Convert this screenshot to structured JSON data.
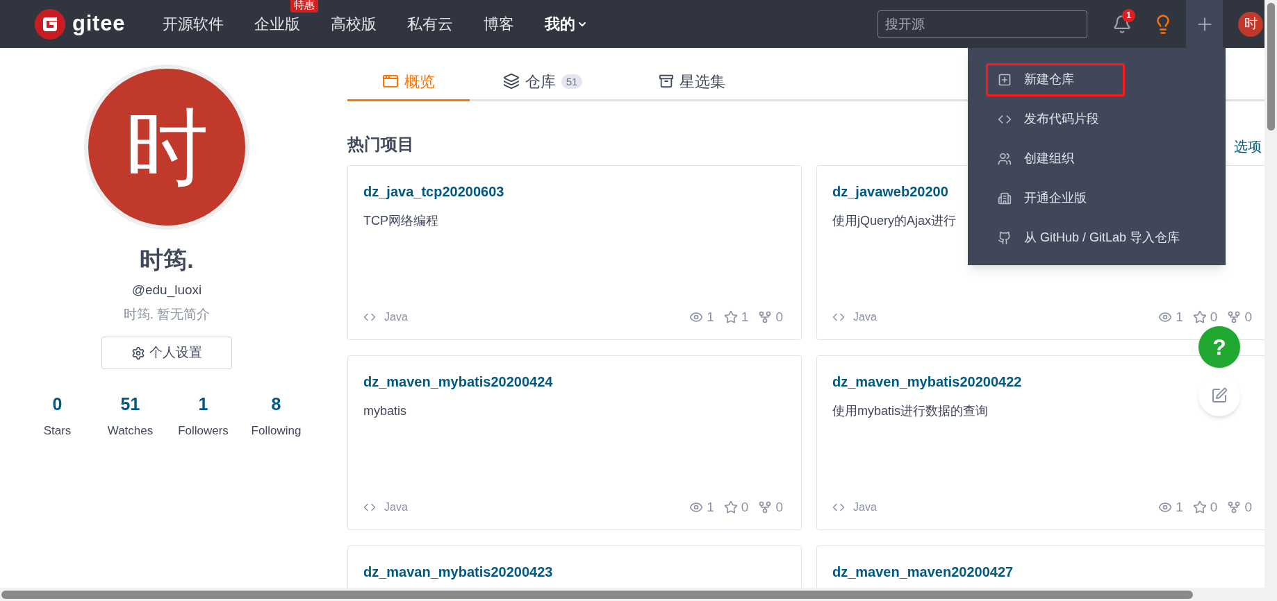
{
  "header": {
    "logo_text": "gitee",
    "nav": [
      {
        "label": "开源软件",
        "selected": false
      },
      {
        "label": "企业版",
        "badge": "特惠",
        "selected": false
      },
      {
        "label": "高校版",
        "selected": false
      },
      {
        "label": "私有云",
        "selected": false
      },
      {
        "label": "博客",
        "selected": false
      },
      {
        "label": "我的",
        "selected": true,
        "dropdown": true
      }
    ],
    "search": {
      "placeholder": "搜开源"
    },
    "notification_count": "1",
    "avatar_text": "时",
    "plus_open": true
  },
  "profile": {
    "avatar_text": "时",
    "name": "时筠.",
    "handle": "@edu_luoxi",
    "bio": "时筠. 暂无简介",
    "settings_button": "个人设置",
    "stats": [
      {
        "value": "0",
        "label": "Stars"
      },
      {
        "value": "51",
        "label": "Watches"
      },
      {
        "value": "1",
        "label": "Followers"
      },
      {
        "value": "8",
        "label": "Following"
      }
    ]
  },
  "tabs": [
    {
      "kind": "overview",
      "label": "概览",
      "selected": true
    },
    {
      "kind": "repos",
      "label": "仓库",
      "count": "51",
      "selected": false
    },
    {
      "kind": "collections",
      "label": "星选集",
      "selected": false
    }
  ],
  "section": {
    "title": "热门项目",
    "link": "选项"
  },
  "projects": [
    {
      "title": "dz_java_tcp20200603",
      "description": "TCP网络编程",
      "language": "Java",
      "watches": "1",
      "stars": "1",
      "forks": "0"
    },
    {
      "title": "dz_javaweb20200",
      "description": "使用jQuery的Ajax进行",
      "language": "Java",
      "watches": "1",
      "stars": "0",
      "forks": "0"
    },
    {
      "title": "dz_maven_mybatis20200424",
      "description": "mybatis",
      "language": "Java",
      "watches": "1",
      "stars": "0",
      "forks": "0"
    },
    {
      "title": "dz_maven_mybatis20200422",
      "description": "使用mybatis进行数据的查询",
      "language": "Java",
      "watches": "1",
      "stars": "0",
      "forks": "0"
    },
    {
      "title": "dz_mavan_mybatis20200423"
    },
    {
      "title": "dz_maven_maven20200427"
    }
  ],
  "menu": [
    {
      "kind": "new-repo",
      "label": "新建仓库",
      "highlighted": true
    },
    {
      "kind": "snippet",
      "label": "发布代码片段",
      "highlighted": false
    },
    {
      "kind": "org",
      "label": "创建组织",
      "highlighted": false
    },
    {
      "kind": "enterprise",
      "label": "开通企业版",
      "highlighted": false
    },
    {
      "kind": "import",
      "label": "从 GitHub / GitLab 导入仓库",
      "highlighted": false
    }
  ],
  "help_button": "?"
}
